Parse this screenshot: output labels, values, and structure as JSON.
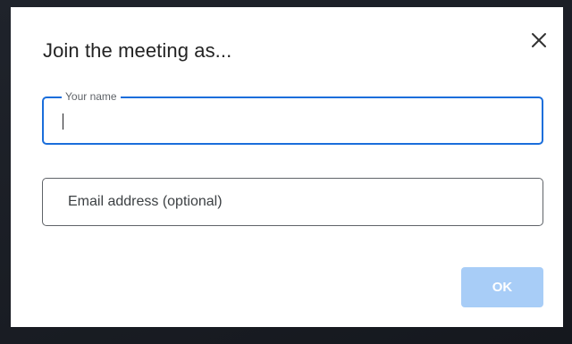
{
  "dialog": {
    "title": "Join the meeting as...",
    "close_icon": "close-icon",
    "name_field": {
      "label": "Your name",
      "value": ""
    },
    "email_field": {
      "placeholder": "Email address (optional)",
      "value": ""
    },
    "ok_label": "OK"
  },
  "colors": {
    "focus_border": "#1a6edb",
    "ok_button_disabled": "#a8cdf7",
    "background": "#1b1f27"
  }
}
